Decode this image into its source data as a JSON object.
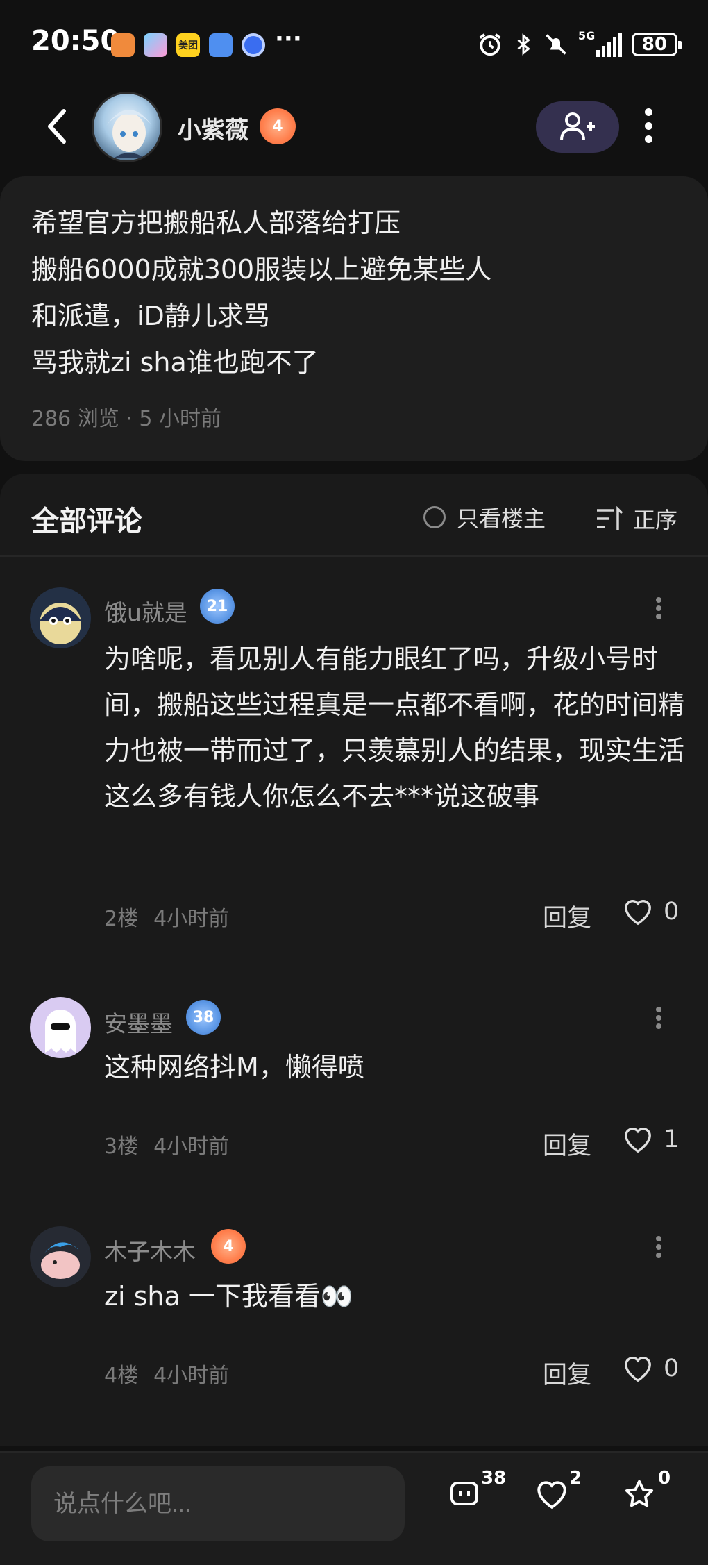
{
  "status_bar": {
    "time": "20:50",
    "signal_label": "5G",
    "battery": "80",
    "overflow_glyph": "···",
    "app_icons": [
      "orange-app-icon",
      "game-app-icon",
      "meituan-app-icon",
      "blue-app-icon",
      "browser-app-icon"
    ],
    "app_icon_text": "美团"
  },
  "header": {
    "username": "小紫薇",
    "level": "4"
  },
  "post": {
    "lines": [
      "希望官方把搬船私人部落给打压",
      "搬船6000成就300服装以上避免某些人",
      "和派遣，iD静儿求骂",
      "骂我就zi sha谁也跑不了"
    ],
    "meta": "286 浏览 · 5 小时前"
  },
  "comments_section": {
    "title": "全部评论",
    "op_only_label": "只看楼主",
    "sort_label": "正序"
  },
  "comments": [
    {
      "name": "饿u就是",
      "level": "21",
      "text": "为啥呢，看见别人有能力眼红了吗，升级小号时间，搬船这些过程真是一点都不看啊，花的时间精力也被一带而过了，只羡慕别人的结果，现实生活这么多有钱人你怎么不去***说这破事",
      "floor": "2楼",
      "time": "4小时前",
      "reply": "回复",
      "likes": "0"
    },
    {
      "name": "安墨墨",
      "level": "38",
      "text": "这种网络抖M，懒得喷",
      "floor": "3楼",
      "time": "4小时前",
      "reply": "回复",
      "likes": "1"
    },
    {
      "name": "木子木木",
      "level": "4",
      "text": "zi sha 一下我看看👀",
      "floor": "4楼",
      "time": "4小时前",
      "reply": "回复",
      "likes": "0"
    }
  ],
  "bottom_bar": {
    "input_placeholder": "说点什么吧...",
    "comment_count": "38",
    "like_count": "2",
    "favorite_count": "0"
  },
  "colors": {
    "background": "#111111",
    "card": "#1e1e1e",
    "follow_button": "#34304f",
    "level_orange": "#ff7f4d",
    "level_blue": "#5d98e6",
    "muted_text": "#7a7a7a"
  }
}
